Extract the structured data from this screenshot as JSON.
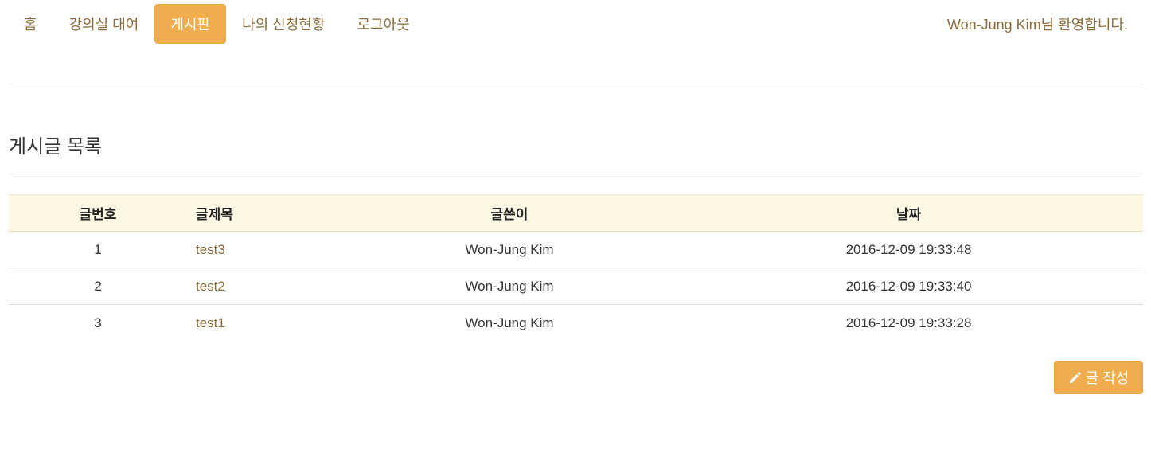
{
  "nav": {
    "items": [
      {
        "label": "홈"
      },
      {
        "label": "강의실 대여"
      },
      {
        "label": "게시판"
      },
      {
        "label": "나의 신청현황"
      },
      {
        "label": "로그아웃"
      }
    ],
    "active_label": "게시판",
    "welcome": "Won-Jung Kim님 환영합니다."
  },
  "page": {
    "title": "게시글 목록"
  },
  "table": {
    "headers": {
      "number": "글번호",
      "title": "글제목",
      "writer": "글쓴이",
      "date": "날짜"
    },
    "rows": [
      {
        "number": "1",
        "title": "test3",
        "writer": "Won-Jung Kim",
        "date": "2016-12-09 19:33:48"
      },
      {
        "number": "2",
        "title": "test2",
        "writer": "Won-Jung Kim",
        "date": "2016-12-09 19:33:40"
      },
      {
        "number": "3",
        "title": "test1",
        "writer": "Won-Jung Kim",
        "date": "2016-12-09 19:33:28"
      }
    ]
  },
  "actions": {
    "write_label": "글 작성",
    "write_icon": "pencil-icon"
  },
  "colors": {
    "accent": "#f0ad4e",
    "link": "#8a6d3b",
    "header_bg": "#fcf8e3"
  }
}
